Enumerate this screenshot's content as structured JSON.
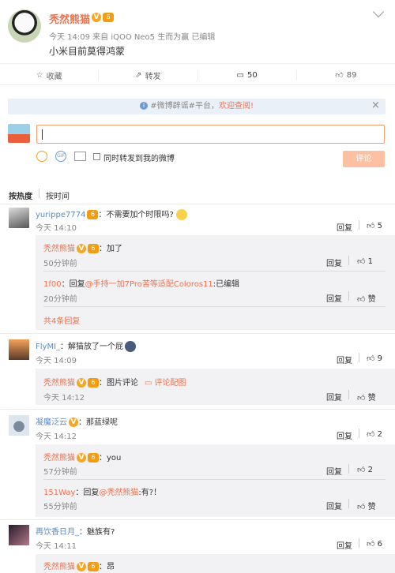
{
  "post": {
    "author": "秃然熊猫",
    "verified": "V",
    "level": "6",
    "meta": "今天 14:09 来自 iQOO Neo5 生而为赢  已编辑",
    "text": "小米目前莫得鸿蒙",
    "dropdown_icon": "chevron-down-icon"
  },
  "actions": {
    "favorite": "收藏",
    "repost": "转发",
    "comment_count": "50",
    "like_count": "89"
  },
  "notice": {
    "text_hash": "#微博辟谣#平台，",
    "text_link": "欢迎查阅!",
    "close": "×"
  },
  "composer": {
    "sync_label": "同时转发到我的微博",
    "submit": "评论",
    "gif": "GIF"
  },
  "sort": {
    "hot": "按热度",
    "time": "按时间"
  },
  "comments": [
    {
      "user": "yurippe7774",
      "text": "：不需要加个时限吗?",
      "time": "今天 14:10",
      "reply": "回复",
      "likes": "5",
      "replies": [
        {
          "user": "秃然熊猫",
          "text": "：加了",
          "time": "50分钟前",
          "reply": "回复",
          "likes": "1"
        },
        {
          "user": "1f00",
          "prefix": "：回复",
          "mention": "@手持一加7Pro苦等适配Coloros11",
          "text": ":已编辑",
          "time": "20分钟前",
          "reply": "回复",
          "likes": "赞"
        }
      ],
      "more": "共4条回复"
    },
    {
      "user": "FlyMI_",
      "text": "：解猫放了一个屁",
      "time": "今天 14:09",
      "reply": "回复",
      "likes": "9",
      "replies": [
        {
          "user": "秃然熊猫",
          "text": "：图片评论",
          "link": "评论配图",
          "time": "今天 14:12",
          "reply": "回复",
          "likes": "赞"
        }
      ]
    },
    {
      "user": "凝魔泛云",
      "text": "：那蓝绿呢",
      "time": "今天 14:12",
      "reply": "回复",
      "likes": "2",
      "replies": [
        {
          "user": "秃然熊猫",
          "text": "：you",
          "time": "57分钟前",
          "reply": "回复",
          "likes": "2"
        },
        {
          "user": "151Way",
          "prefix": "：回复",
          "mention": "@秃然熊猫",
          "text": ":有?！",
          "time": "55分钟前",
          "reply": "回复",
          "likes": "赞"
        }
      ]
    },
    {
      "user": "再饮香日月_",
      "text": "：魅族有?",
      "time": "今天 14:11",
      "reply": "回复",
      "likes": "6",
      "replies": [
        {
          "user": "秃然熊猫",
          "text": "：昂"
        }
      ]
    }
  ]
}
